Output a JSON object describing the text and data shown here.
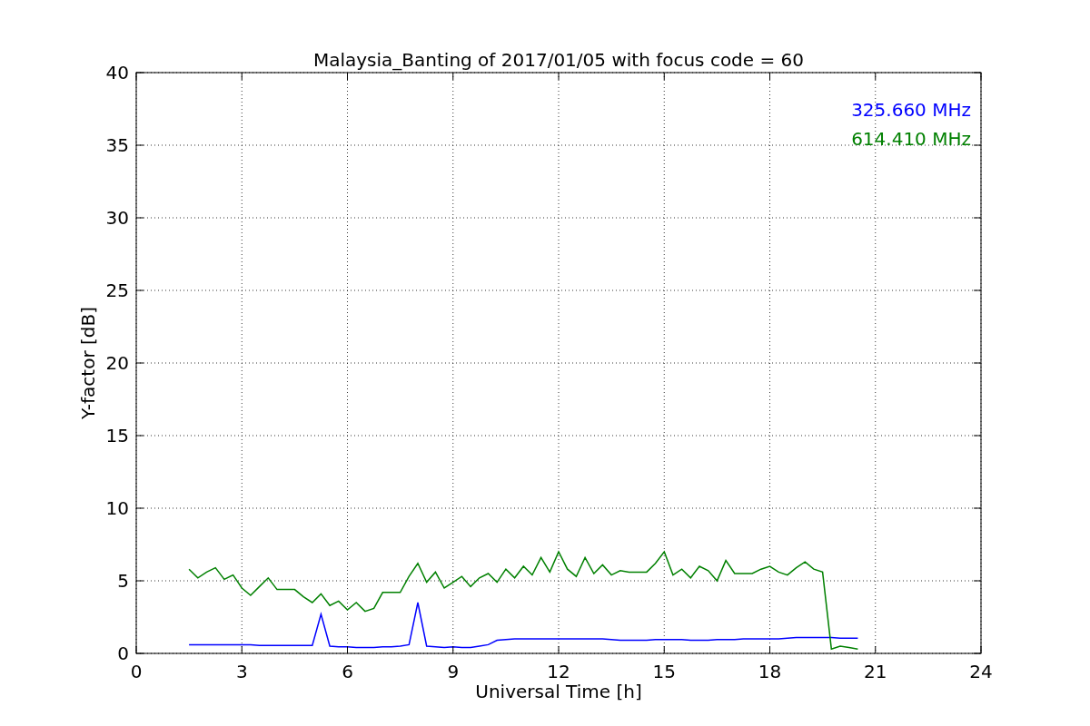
{
  "chart": {
    "chart_data": {
      "type": "line",
      "title": "Malaysia_Banting of 2017/01/05 with focus code = 60",
      "xlabel": "Universal Time [h]",
      "ylabel": "Y-factor [dB]",
      "x": [
        1.5,
        1.75,
        2,
        2.25,
        2.5,
        2.75,
        3,
        3.25,
        3.5,
        3.75,
        4,
        4.25,
        4.5,
        4.75,
        5,
        5.25,
        5.5,
        5.75,
        6,
        6.25,
        6.5,
        6.75,
        7,
        7.25,
        7.5,
        7.75,
        8,
        8.25,
        8.5,
        8.75,
        9,
        9.25,
        9.5,
        9.75,
        10,
        10.25,
        10.5,
        10.75,
        11,
        11.25,
        11.5,
        11.75,
        12,
        12.25,
        12.5,
        12.75,
        13,
        13.25,
        13.5,
        13.75,
        14,
        14.25,
        14.5,
        14.75,
        15,
        15.25,
        15.5,
        15.75,
        16,
        16.25,
        16.5,
        16.75,
        17,
        17.25,
        17.5,
        17.75,
        18,
        18.25,
        18.5,
        18.75,
        19,
        19.25,
        19.5,
        19.75,
        20,
        20.25,
        20.5
      ],
      "series": [
        {
          "name": "325.660 MHz",
          "color": "#0000ff",
          "values": [
            0.6,
            0.6,
            0.6,
            0.6,
            0.6,
            0.6,
            0.6,
            0.6,
            0.55,
            0.55,
            0.55,
            0.55,
            0.55,
            0.55,
            0.55,
            2.7,
            0.5,
            0.45,
            0.45,
            0.4,
            0.4,
            0.4,
            0.45,
            0.45,
            0.5,
            0.6,
            3.5,
            0.5,
            0.45,
            0.4,
            0.45,
            0.4,
            0.4,
            0.5,
            0.6,
            0.9,
            0.95,
            1.0,
            1.0,
            1.0,
            1.0,
            1.0,
            1.0,
            1.0,
            1.0,
            1.0,
            1.0,
            1.0,
            0.95,
            0.9,
            0.9,
            0.9,
            0.9,
            0.95,
            0.95,
            0.95,
            0.95,
            0.9,
            0.9,
            0.9,
            0.95,
            0.95,
            0.95,
            1.0,
            1.0,
            1.0,
            1.0,
            1.0,
            1.05,
            1.1,
            1.1,
            1.1,
            1.1,
            1.1,
            1.05,
            1.05,
            1.05
          ]
        },
        {
          "name": "614.410 MHz",
          "color": "#008000",
          "values": [
            5.8,
            5.2,
            5.6,
            5.9,
            5.1,
            5.4,
            4.5,
            4.0,
            4.6,
            5.2,
            4.4,
            4.4,
            4.4,
            3.9,
            3.5,
            4.1,
            3.3,
            3.6,
            3.0,
            3.5,
            2.9,
            3.1,
            4.2,
            4.2,
            4.2,
            5.3,
            6.2,
            4.9,
            5.6,
            4.5,
            4.9,
            5.3,
            4.6,
            5.2,
            5.5,
            4.9,
            5.8,
            5.2,
            6.0,
            5.4,
            6.6,
            5.6,
            7.0,
            5.8,
            5.3,
            6.6,
            5.5,
            6.1,
            5.4,
            5.7,
            5.6,
            5.6,
            5.6,
            6.2,
            7.0,
            5.4,
            5.8,
            5.2,
            6.0,
            5.7,
            5.0,
            6.4,
            5.5,
            5.5,
            5.5,
            5.8,
            6.0,
            5.6,
            5.4,
            5.9,
            6.3,
            5.8,
            5.6,
            0.3,
            0.5,
            0.4,
            0.3
          ]
        }
      ],
      "grid": true,
      "xlim": [
        0,
        24
      ],
      "ylim": [
        0,
        40
      ],
      "xticks": [
        0,
        3,
        6,
        9,
        12,
        15,
        18,
        21,
        24
      ],
      "yticks": [
        0,
        5,
        10,
        15,
        20,
        25,
        30,
        35,
        40
      ]
    }
  }
}
